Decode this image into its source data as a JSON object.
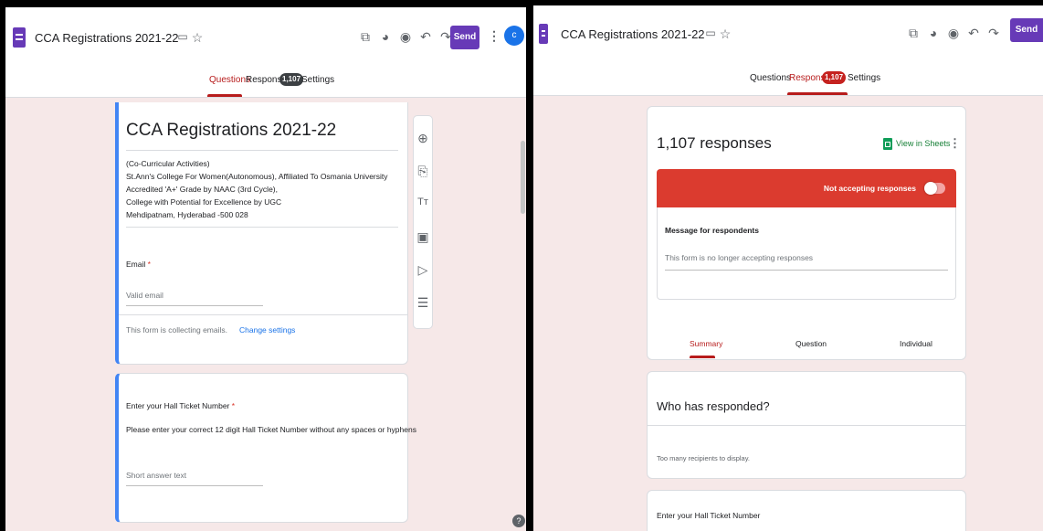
{
  "app": {
    "title": "CCA Registrations 2021-22",
    "send_label": "Send",
    "avatar_initial": "c",
    "tabs": {
      "questions": "Questions",
      "responses": "Responses",
      "settings": "Settings",
      "responses_count": "1,107"
    }
  },
  "left": {
    "form_title": "CCA Registrations 2021-22",
    "description_lines": [
      "(Co-Curricular Activities)",
      "St.Ann's College For Women(Autonomous), Affiliated To Osmania University",
      "Accredited 'A+' Grade by NAAC (3rd Cycle),",
      "College with Potential for Excellence by UGC",
      "Mehdipatnam, Hyderabad -500 028"
    ],
    "email_label": "Email",
    "required_mark": "*",
    "email_placeholder": "Valid email",
    "collecting_text": "This form is collecting emails.",
    "change_settings": "Change settings",
    "q2_title": "Enter your Hall Ticket Number",
    "q2_description": "Please enter your correct 12 digit Hall Ticket Number without any spaces or hyphens",
    "q2_placeholder": "Short answer text",
    "help": "?"
  },
  "right": {
    "responses_heading": "1,107 responses",
    "view_in_sheets": "View in Sheets",
    "not_accepting": "Not accepting responses",
    "message_label": "Message for respondents",
    "message_text": "This form is no longer accepting responses",
    "subtabs": {
      "summary": "Summary",
      "question": "Question",
      "individual": "Individual"
    },
    "who_title": "Who has responded?",
    "who_text": "Too many recipients to display.",
    "next_title": "Enter your Hall Ticket Number"
  },
  "colors": {
    "accent": "#673ab7",
    "red": "#db3b2f",
    "active_tab": "#b71c1c",
    "link": "#1a73e8"
  }
}
